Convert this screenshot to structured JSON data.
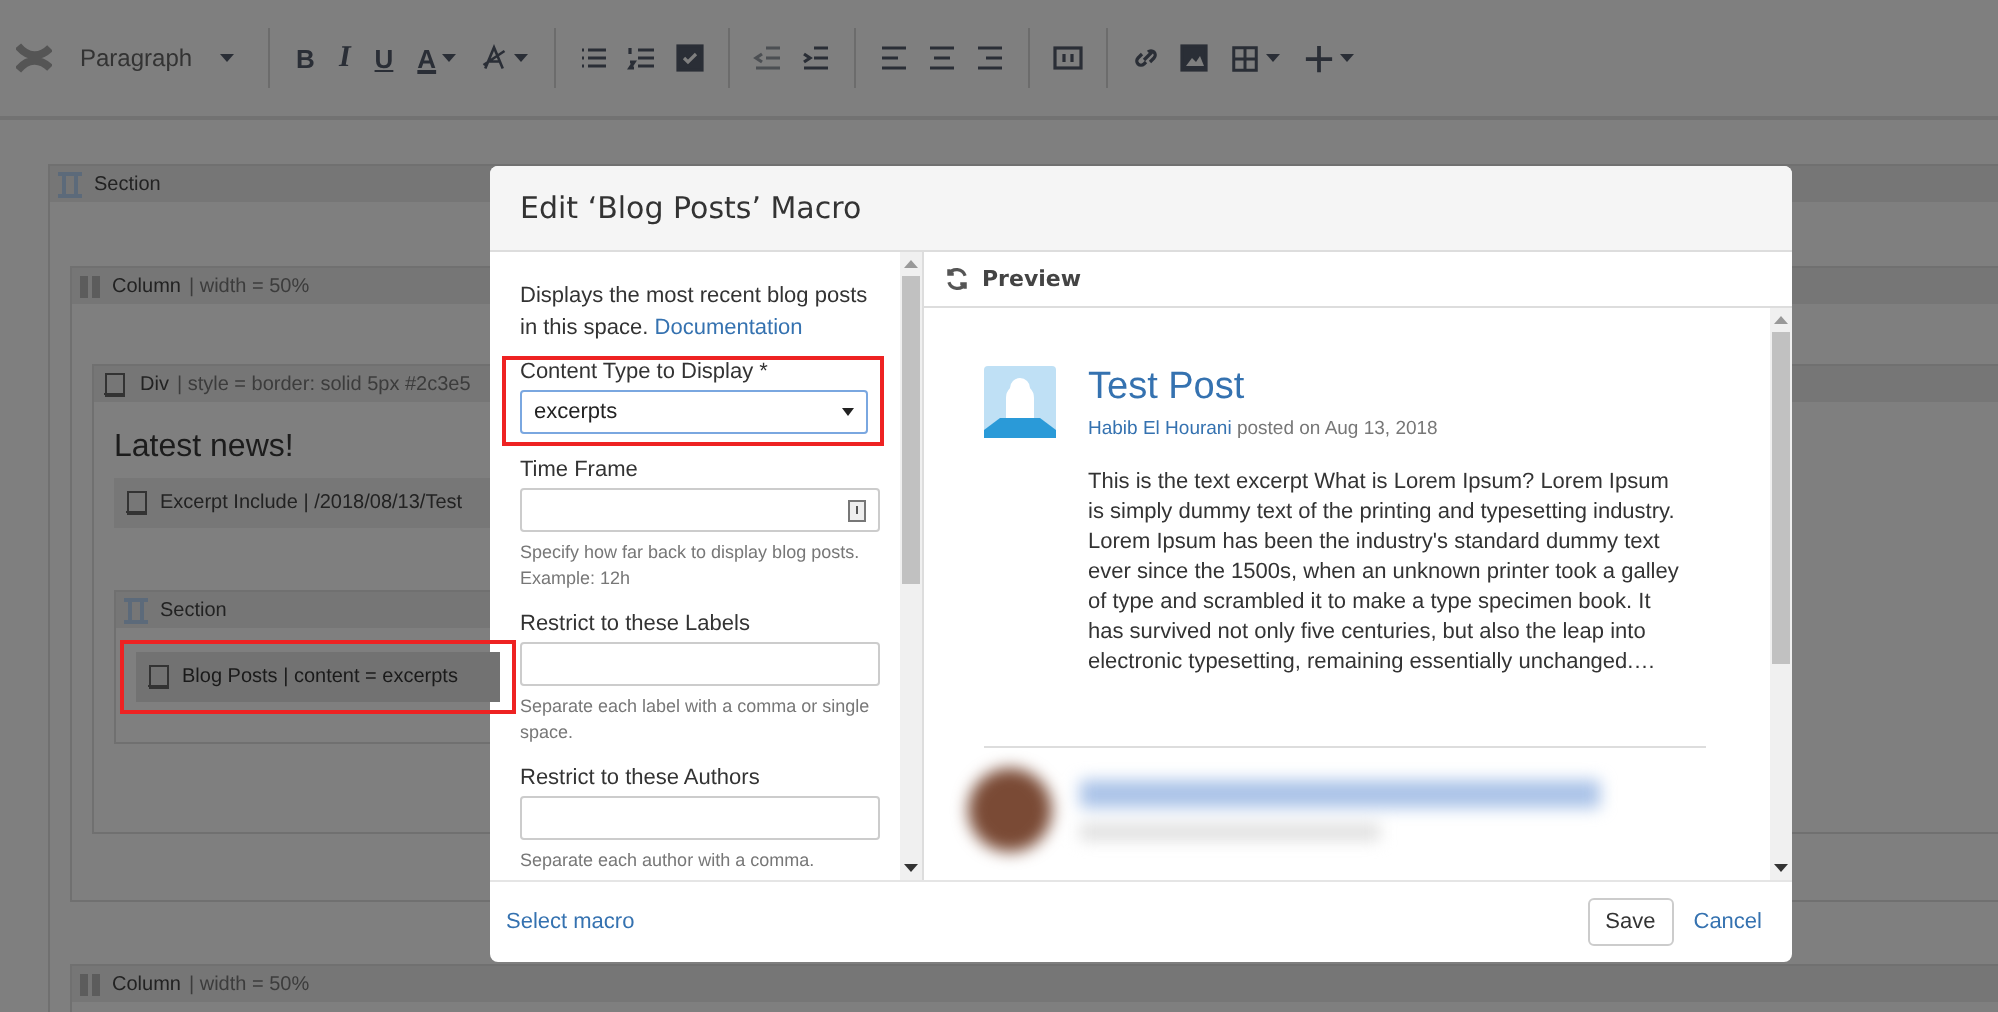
{
  "toolbar": {
    "format_dropdown": "Paragraph",
    "buttons": [
      {
        "kind": "bold",
        "label": "B"
      },
      {
        "kind": "italic",
        "label": "I"
      },
      {
        "kind": "underline",
        "label": "U"
      },
      {
        "kind": "text-color",
        "label": "A"
      }
    ]
  },
  "editor": {
    "section": {
      "title": "Section"
    },
    "column": {
      "title": "Column",
      "param": "| width = 50%"
    },
    "div": {
      "title": "Div",
      "param": "| style = border: solid 5px #2c3e5"
    },
    "heading": "Latest news!",
    "excerpt_macro": {
      "title": "Excerpt Include",
      "param": "| /2018/08/13/Test"
    },
    "inner_section": {
      "title": "Section"
    },
    "blog_macro": {
      "title": "Blog Posts",
      "param": "| content = excerpts",
      "highlighted": true
    },
    "column_2": {
      "title": "Column",
      "param": "| width = 50%"
    }
  },
  "dialog": {
    "title": "Edit ‘Blog Posts’ Macro",
    "description": "Displays the most recent blog posts in this space.",
    "documentation_link": "Documentation",
    "fields": [
      {
        "kind": "select",
        "label": "Content Type to Display *",
        "value": "excerpts",
        "highlighted": true
      },
      {
        "kind": "picker",
        "label": "Time Frame",
        "help": "Specify how far back to display blog posts. Example: 12h",
        "highlighted": false
      },
      {
        "kind": "text",
        "label": "Restrict to these Labels",
        "help": "Separate each label with a comma or single space.",
        "highlighted": false
      },
      {
        "kind": "text",
        "label": "Restrict to these Authors",
        "help": "Separate each author with a comma.",
        "highlighted": false
      }
    ],
    "preview": {
      "title": "Preview",
      "posts": [
        {
          "title": "Test Post",
          "author": "Habib El Hourani",
          "meta": "posted on Aug 13, 2018",
          "excerpt": "This is the text excerpt What is Lorem Ipsum? Lorem Ipsum is simply dummy text of the printing and typesetting industry. Lorem Ipsum has been the industry's standard dummy text ever since the 1500s, when an unknown printer took a galley of type and scrambled it to make a type specimen book. It has survived not only five centuries, but also the leap into electronic typesetting, remaining essentially unchanged.…"
        }
      ]
    },
    "footer": {
      "link": "Select macro",
      "buttons": [
        {
          "kind": "primary",
          "label": "Save"
        },
        {
          "kind": "link",
          "label": "Cancel"
        }
      ]
    }
  }
}
